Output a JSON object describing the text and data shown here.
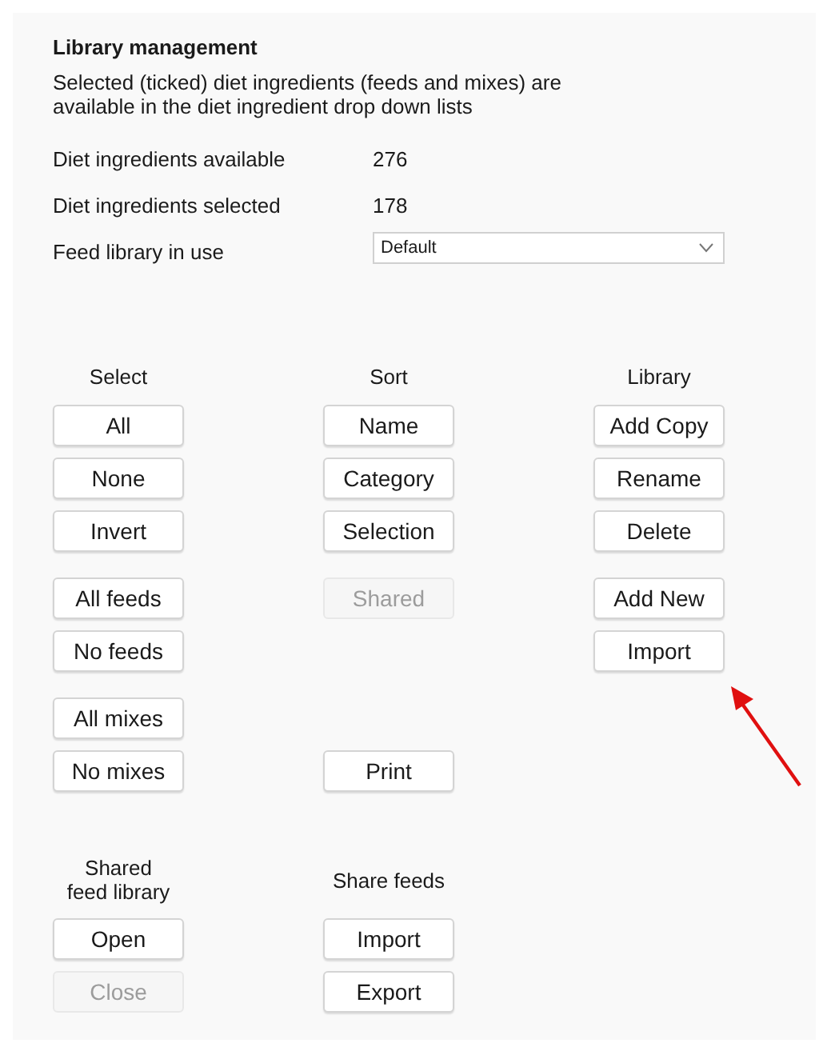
{
  "title": "Library management",
  "description": "Selected (ticked) diet ingredients (feeds and mixes) are available in the diet ingredient drop down lists",
  "stats": [
    {
      "label": "Diet ingredients available",
      "value": "276"
    },
    {
      "label": "Diet ingredients selected",
      "value": "178"
    }
  ],
  "feed_library": {
    "label": "Feed library in use",
    "value": "Default"
  },
  "columns": [
    "Select",
    "Sort",
    "Library"
  ],
  "groups": [
    {
      "rows": [
        {
          "select": {
            "label": "All",
            "disabled": false
          },
          "sort": {
            "label": "Name",
            "disabled": false
          },
          "library": {
            "label": "Add Copy",
            "disabled": false
          }
        },
        {
          "select": {
            "label": "None",
            "disabled": false
          },
          "sort": {
            "label": "Category",
            "disabled": false
          },
          "library": {
            "label": "Rename",
            "disabled": false
          }
        },
        {
          "select": {
            "label": "Invert",
            "disabled": false
          },
          "sort": {
            "label": "Selection",
            "disabled": false
          },
          "library": {
            "label": "Delete",
            "disabled": false
          }
        }
      ]
    },
    {
      "rows": [
        {
          "select": {
            "label": "All feeds",
            "disabled": false
          },
          "sort": {
            "label": "Shared",
            "disabled": true
          },
          "library": {
            "label": "Add New",
            "disabled": false
          }
        },
        {
          "select": {
            "label": "No feeds",
            "disabled": false
          },
          "library": {
            "label": "Import",
            "disabled": false
          }
        }
      ]
    },
    {
      "rows": [
        {
          "select": {
            "label": "All mixes",
            "disabled": false
          }
        },
        {
          "select": {
            "label": "No mixes",
            "disabled": false
          },
          "sort": {
            "label": "Print",
            "disabled": false
          }
        }
      ]
    }
  ],
  "shared_library": {
    "heading": "Shared\nfeed library",
    "buttons": [
      {
        "label": "Open",
        "disabled": false
      },
      {
        "label": "Close",
        "disabled": true
      }
    ]
  },
  "share_feeds": {
    "heading": "Share feeds",
    "buttons": [
      {
        "label": "Import",
        "disabled": false
      },
      {
        "label": "Export",
        "disabled": false
      }
    ]
  }
}
